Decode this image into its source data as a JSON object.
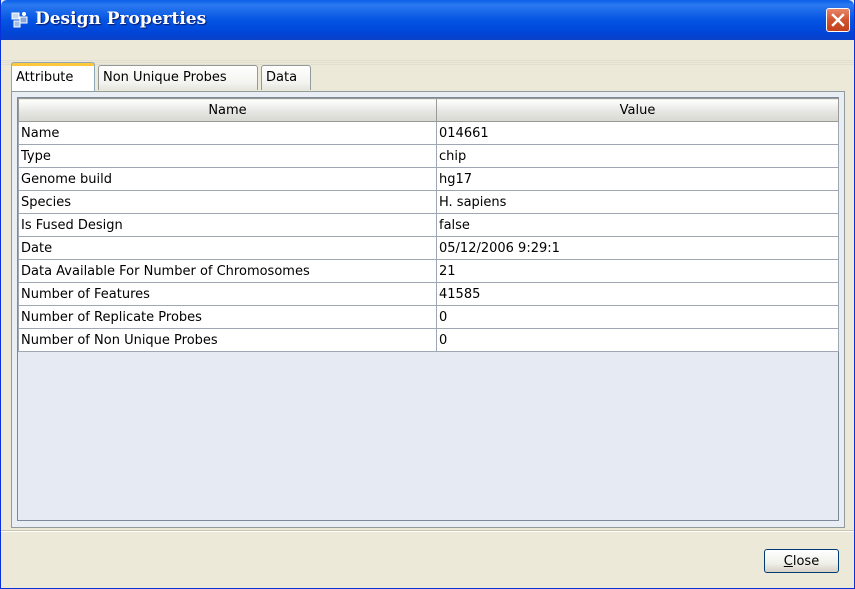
{
  "window": {
    "title": "Design Properties"
  },
  "tabs": [
    {
      "label": "Attribute",
      "active": true
    },
    {
      "label": "Non Unique Probes",
      "active": false
    },
    {
      "label": "Data",
      "active": false
    }
  ],
  "table": {
    "columns": [
      "Name",
      "Value"
    ],
    "rows": [
      {
        "name": "Name",
        "value": "014661"
      },
      {
        "name": "Type",
        "value": "chip"
      },
      {
        "name": "Genome build",
        "value": "hg17"
      },
      {
        "name": "Species",
        "value": "H. sapiens"
      },
      {
        "name": "Is Fused Design",
        "value": "false"
      },
      {
        "name": "Date",
        "value": "05/12/2006 9:29:1"
      },
      {
        "name": "Data Available For Number of Chromosomes",
        "value": "21"
      },
      {
        "name": "Number of Features",
        "value": "41585"
      },
      {
        "name": "Number of Replicate Probes",
        "value": "0"
      },
      {
        "name": "Number of Non Unique Probes",
        "value": "0"
      }
    ]
  },
  "footer": {
    "close_label_mnemonic": "C",
    "close_label_rest": "lose"
  }
}
